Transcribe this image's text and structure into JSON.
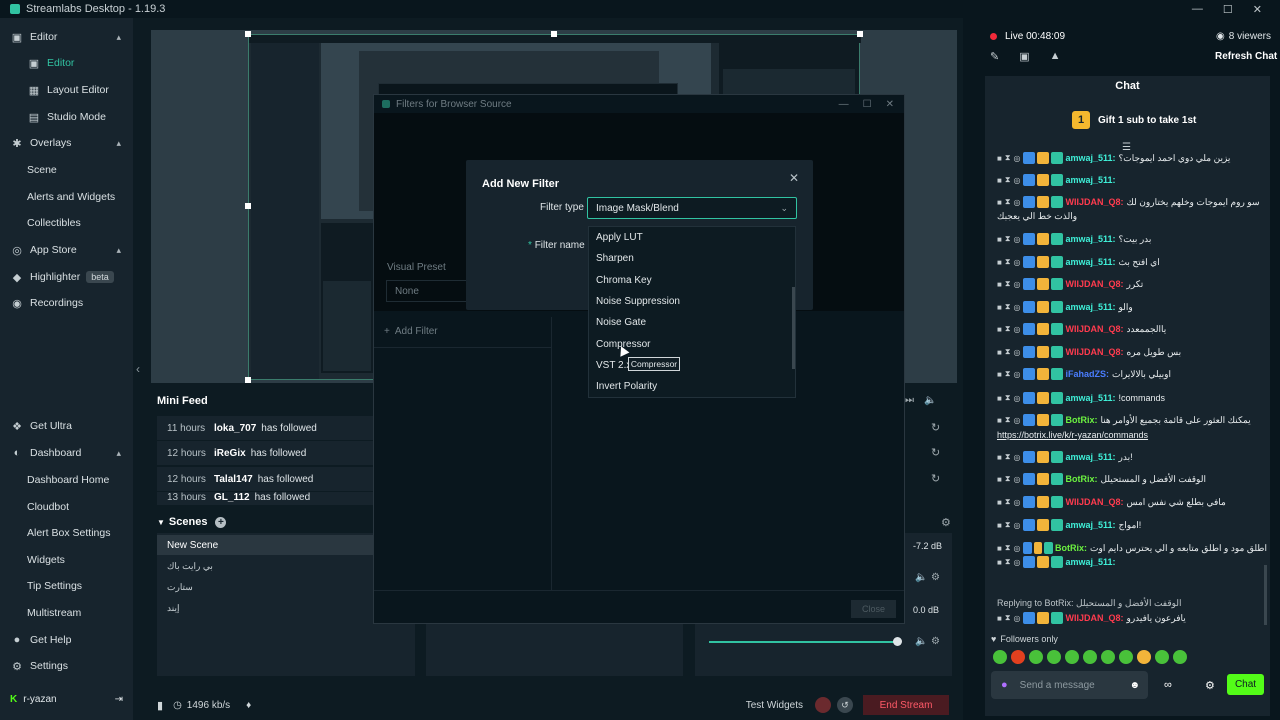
{
  "window": {
    "title": "Streamlabs Desktop - 1.19.3"
  },
  "sidebar": {
    "items": [
      {
        "label": "Editor",
        "icon": "editor-icon",
        "level": "top",
        "chevron": true
      },
      {
        "label": "Editor",
        "icon": "editor-icon",
        "level": "sub",
        "active": true
      },
      {
        "label": "Layout Editor",
        "icon": "layout-icon",
        "level": "sub"
      },
      {
        "label": "Studio Mode",
        "icon": "studio-icon",
        "level": "sub"
      },
      {
        "label": "Overlays",
        "icon": "overlays-icon",
        "level": "top",
        "chevron": true
      },
      {
        "label": "Scene",
        "level": "plain"
      },
      {
        "label": "Alerts and Widgets",
        "level": "plain"
      },
      {
        "label": "Collectibles",
        "level": "plain"
      },
      {
        "label": "App Store",
        "icon": "store-icon",
        "level": "top",
        "chevron": true
      },
      {
        "label": "Highlighter",
        "icon": "highlighter-icon",
        "level": "top",
        "badge": "beta"
      },
      {
        "label": "Recordings",
        "icon": "recordings-icon",
        "level": "top"
      },
      {
        "label": "Get Ultra",
        "icon": "ultra-icon",
        "level": "top"
      },
      {
        "label": "Dashboard",
        "icon": "dashboard-icon",
        "level": "top",
        "chevron": true
      },
      {
        "label": "Dashboard Home",
        "level": "plain"
      },
      {
        "label": "Cloudbot",
        "level": "plain"
      },
      {
        "label": "Alert Box Settings",
        "level": "plain"
      },
      {
        "label": "Widgets",
        "level": "plain"
      },
      {
        "label": "Tip Settings",
        "level": "plain"
      },
      {
        "label": "Multistream",
        "level": "plain"
      },
      {
        "label": "Get Help",
        "icon": "help-icon",
        "level": "top"
      },
      {
        "label": "Settings",
        "icon": "gear-icon",
        "level": "top"
      }
    ],
    "user": "r-yazan"
  },
  "minifeed": {
    "title": "Mini Feed",
    "rows": [
      {
        "time": "11 hours",
        "name": "loka_707",
        "action": "has followed"
      },
      {
        "time": "12 hours",
        "name": "iReGix",
        "action": "has followed"
      },
      {
        "time": "12 hours",
        "name": "Talal147",
        "action": "has followed"
      },
      {
        "time": "13 hours",
        "name": "GL_112",
        "action": "has followed"
      }
    ]
  },
  "scenes": {
    "title": "Scenes",
    "items": [
      "New Scene",
      "بي رايت باك",
      "ستارت",
      "إيند"
    ]
  },
  "audio": {
    "db1": "-7.2 dB",
    "db2": "0.0 dB"
  },
  "footer": {
    "bitrate": "1496 kb/s",
    "test_widgets": "Test Widgets",
    "end_stream": "End Stream"
  },
  "filters_window": {
    "title": "Filters for Browser Source",
    "visual_preset_label": "Visual Preset",
    "visual_preset_value": "None",
    "add_filter": "Add Filter",
    "close": "Close"
  },
  "add_filter_dialog": {
    "title": "Add New Filter",
    "filter_type_label": "Filter type",
    "filter_type_value": "Image Mask/Blend",
    "filter_name_label": "Filter name",
    "options": [
      "Apply LUT",
      "Sharpen",
      "Chroma Key",
      "Noise Suppression",
      "Noise Gate",
      "Compressor",
      "VST 2.x",
      "Invert Polarity"
    ],
    "tooltip": "Compressor"
  },
  "stream": {
    "live": "Live 00:48:09",
    "viewers": "8 viewers",
    "refresh": "Refresh Chat"
  },
  "chat": {
    "title": "Chat",
    "gift": "Gift 1 sub to take 1st",
    "messages": [
      {
        "user": "amwaj_511:",
        "color": "#3ff0d8",
        "text": "يزين ملي دوي احمد ايموجات؟"
      },
      {
        "user": "amwaj_511:",
        "color": "#3ff0d8",
        "text": ""
      },
      {
        "user": "WIIJDAN_Q8:",
        "color": "#ff3b4e",
        "text": "سو روم ايموجات وخلهم يختارون لك"
      },
      {
        "user": "",
        "color": "#ffffff",
        "text": "والذت خط الي يعجبك"
      },
      {
        "user": "amwaj_511:",
        "color": "#3ff0d8",
        "text": "بدر بيت؟"
      },
      {
        "user": "amwaj_511:",
        "color": "#3ff0d8",
        "text": "اي افتح بث"
      },
      {
        "user": "WIIJDAN_Q8:",
        "color": "#ff3b4e",
        "text": "تكرر"
      },
      {
        "user": "amwaj_511:",
        "color": "#3ff0d8",
        "text": "والو"
      },
      {
        "user": "WIIJDAN_Q8:",
        "color": "#ff3b4e",
        "text": "ياالجممعدد"
      },
      {
        "user": "WIIJDAN_Q8:",
        "color": "#ff3b4e",
        "text": "بس طويل مره"
      },
      {
        "user": "iFahadZS:",
        "color": "#4a7dff",
        "text": "اوبيلي بالالايرات"
      },
      {
        "user": "amwaj_511:",
        "color": "#3ff0d8",
        "text": "!commands"
      },
      {
        "user": "BotRix:",
        "color": "#6cf240",
        "text": "يمكنك العثور على قائمة بجميع الأوامر هنا"
      },
      {
        "user": "",
        "color": "#ffffff",
        "text": "https://botrix.live/k/r-yazan/commands"
      },
      {
        "user": "amwaj_511:",
        "color": "#3ff0d8",
        "text": "بدر!"
      },
      {
        "user": "BotRix:",
        "color": "#6cf240",
        "text": "الوقفت الأفضل و المستحيلل"
      },
      {
        "user": "WIIJDAN_Q8:",
        "color": "#ff3b4e",
        "text": "مافي بطلع شي نفس امس"
      },
      {
        "user": "amwaj_511:",
        "color": "#3ff0d8",
        "text": "امواج!"
      },
      {
        "user": "BotRix:",
        "color": "#6cf240",
        "text": "اطلق مود و اطلق متابعه و الي يحترس دايم اوت"
      },
      {
        "user": "amwaj_511:",
        "color": "#3ff0d8",
        "text": ""
      },
      {
        "user": "",
        "color": "#bdc5c9",
        "text": "Replying to BotRix: الوقفت الأفضل و المستحيلل"
      },
      {
        "user": "WIIJDAN_Q8:",
        "color": "#ff3b4e",
        "text": "يافرعون يافيدرو"
      }
    ],
    "followers_only": "Followers only",
    "placeholder": "Send a message",
    "send": "Chat"
  }
}
